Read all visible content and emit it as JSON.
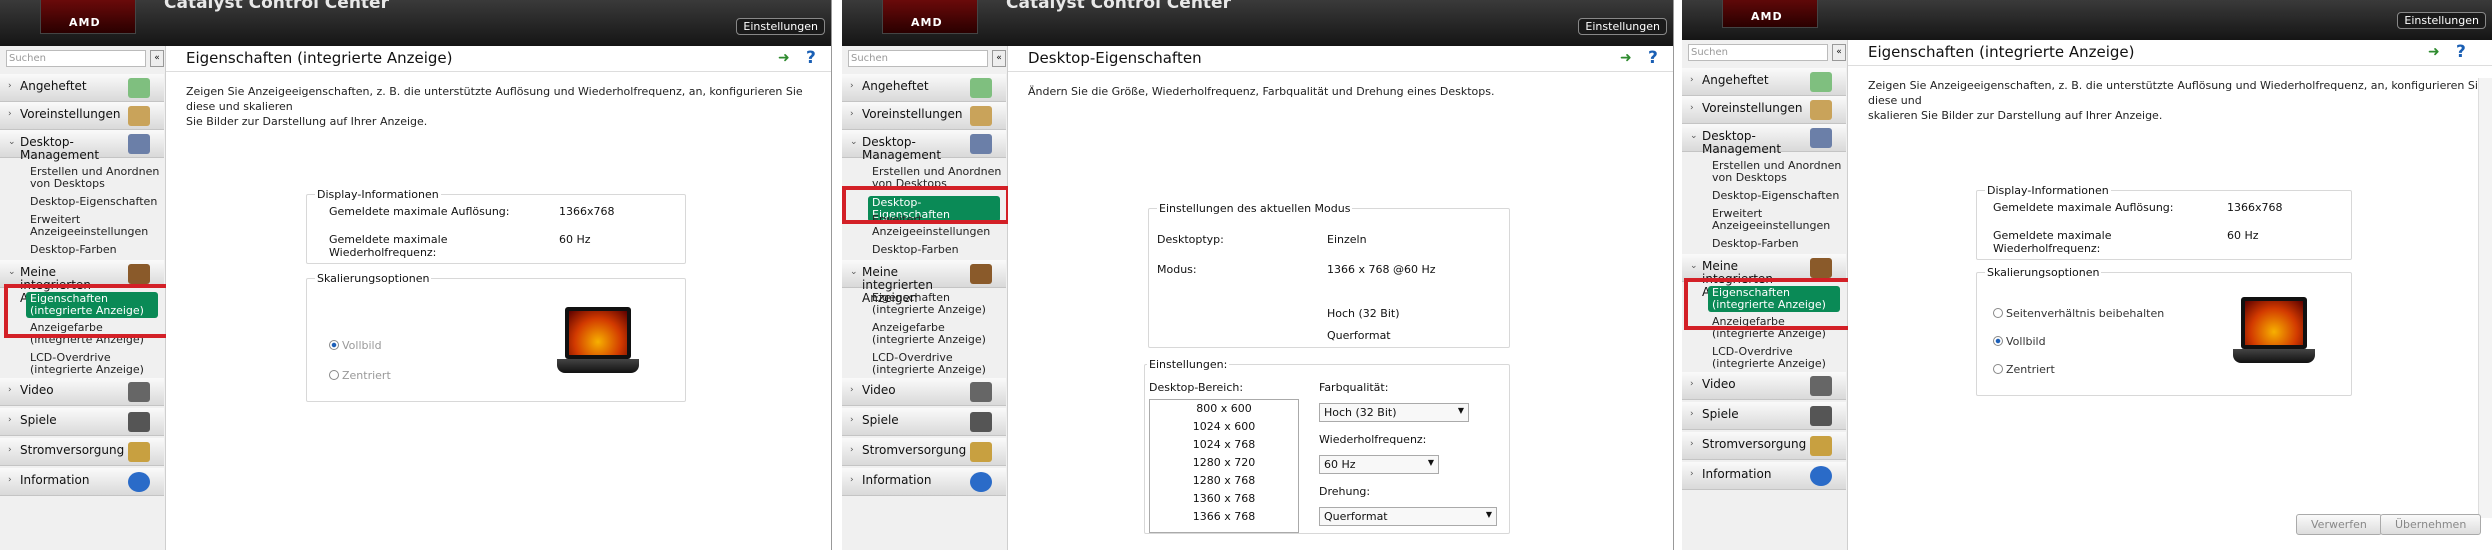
{
  "app": {
    "brand": "AMD",
    "title": "Catalyst Control Center",
    "settings": "Einstellungen"
  },
  "search": {
    "placeholder": "Suchen"
  },
  "nav": {
    "angeheftet": "Angeheftet",
    "voreinstellungen": "Voreinstellungen",
    "desktop_management": "Desktop-Management",
    "erstellen": "Erstellen und Anordnen von Desktops",
    "desktop_eigenschaften": "Desktop-Eigenschaften",
    "erweitert": "Erweitert Anzeigeeinstellungen",
    "desktop_farben": "Desktop-Farben",
    "meine_integrierten": "Meine integrierten Anzeigen",
    "eigenschaften_int": "Eigenschaften (integrierte Anzeige)",
    "anzeigefarbe": "Anzeigefarbe (integrierte Anzeige)",
    "lcd_overdrive": "LCD-Overdrive (integrierte Anzeige)",
    "video": "Video",
    "spiele": "Spiele",
    "stromversorgung": "Stromversorgung",
    "information": "Information"
  },
  "p1": {
    "title": "Eigenschaften (integrierte Anzeige)",
    "desc1": "Zeigen Sie Anzeigeeigenschaften, z. B. die unterstützte Auflösung und Wiederholfrequenz, an, konfigurieren Sie diese und skalieren",
    "desc2": "Sie Bilder zur Darstellung auf Ihrer Anzeige."
  },
  "p3": {
    "desc1": "Zeigen Sie Anzeigeeigenschaften, z. B. die unterstützte Auflösung und Wiederholfrequenz, an, konfigurieren Sie diese und",
    "desc2": "skalieren Sie Bilder zur Darstellung auf Ihrer Anzeige."
  },
  "display": {
    "group": "Display-Informationen",
    "max_res_label": "Gemeldete maximale Auflösung:",
    "max_res": "1366x768",
    "max_freq_label1": "Gemeldete maximale",
    "max_freq_label2": "Wiederholfrequenz:",
    "max_freq": "60 Hz"
  },
  "scaling": {
    "group": "Skalierungsoptionen",
    "keep": "Seitenverhältnis beibehalten",
    "full": "Vollbild",
    "center": "Zentriert"
  },
  "p2": {
    "title": "Desktop-Eigenschaften",
    "desc": "Ändern Sie die Größe, Wiederholfrequenz, Farbqualität und Drehung eines Desktops.",
    "mode_group": "Einstellungen des aktuellen Modus",
    "desktop_type_label": "Desktoptyp:",
    "desktop_type": "Einzeln",
    "mode_label": "Modus:",
    "mode": "1366 x 768 @60 Hz",
    "quality": "Hoch (32 Bit)",
    "orientation": "Querformat",
    "settings_group": "Einstellungen:",
    "area_label": "Desktop-Bereich:",
    "resolutions": [
      "800 x 600",
      "1024 x 600",
      "1024 x 768",
      "1280 x 720",
      "1280 x 768",
      "1360 x 768",
      "1366 x 768"
    ],
    "color_label": "Farbqualität:",
    "color_value": "Hoch (32 Bit)",
    "refresh_label": "Wiederholfrequenz:",
    "refresh_value": "60 Hz",
    "rotation_label": "Drehung:",
    "rotation_value": "Querformat"
  },
  "buttons": {
    "discard": "Verwerfen",
    "apply": "Übernehmen"
  },
  "colors": {
    "highlight": "#d32027",
    "selected": "#0a8a56"
  }
}
